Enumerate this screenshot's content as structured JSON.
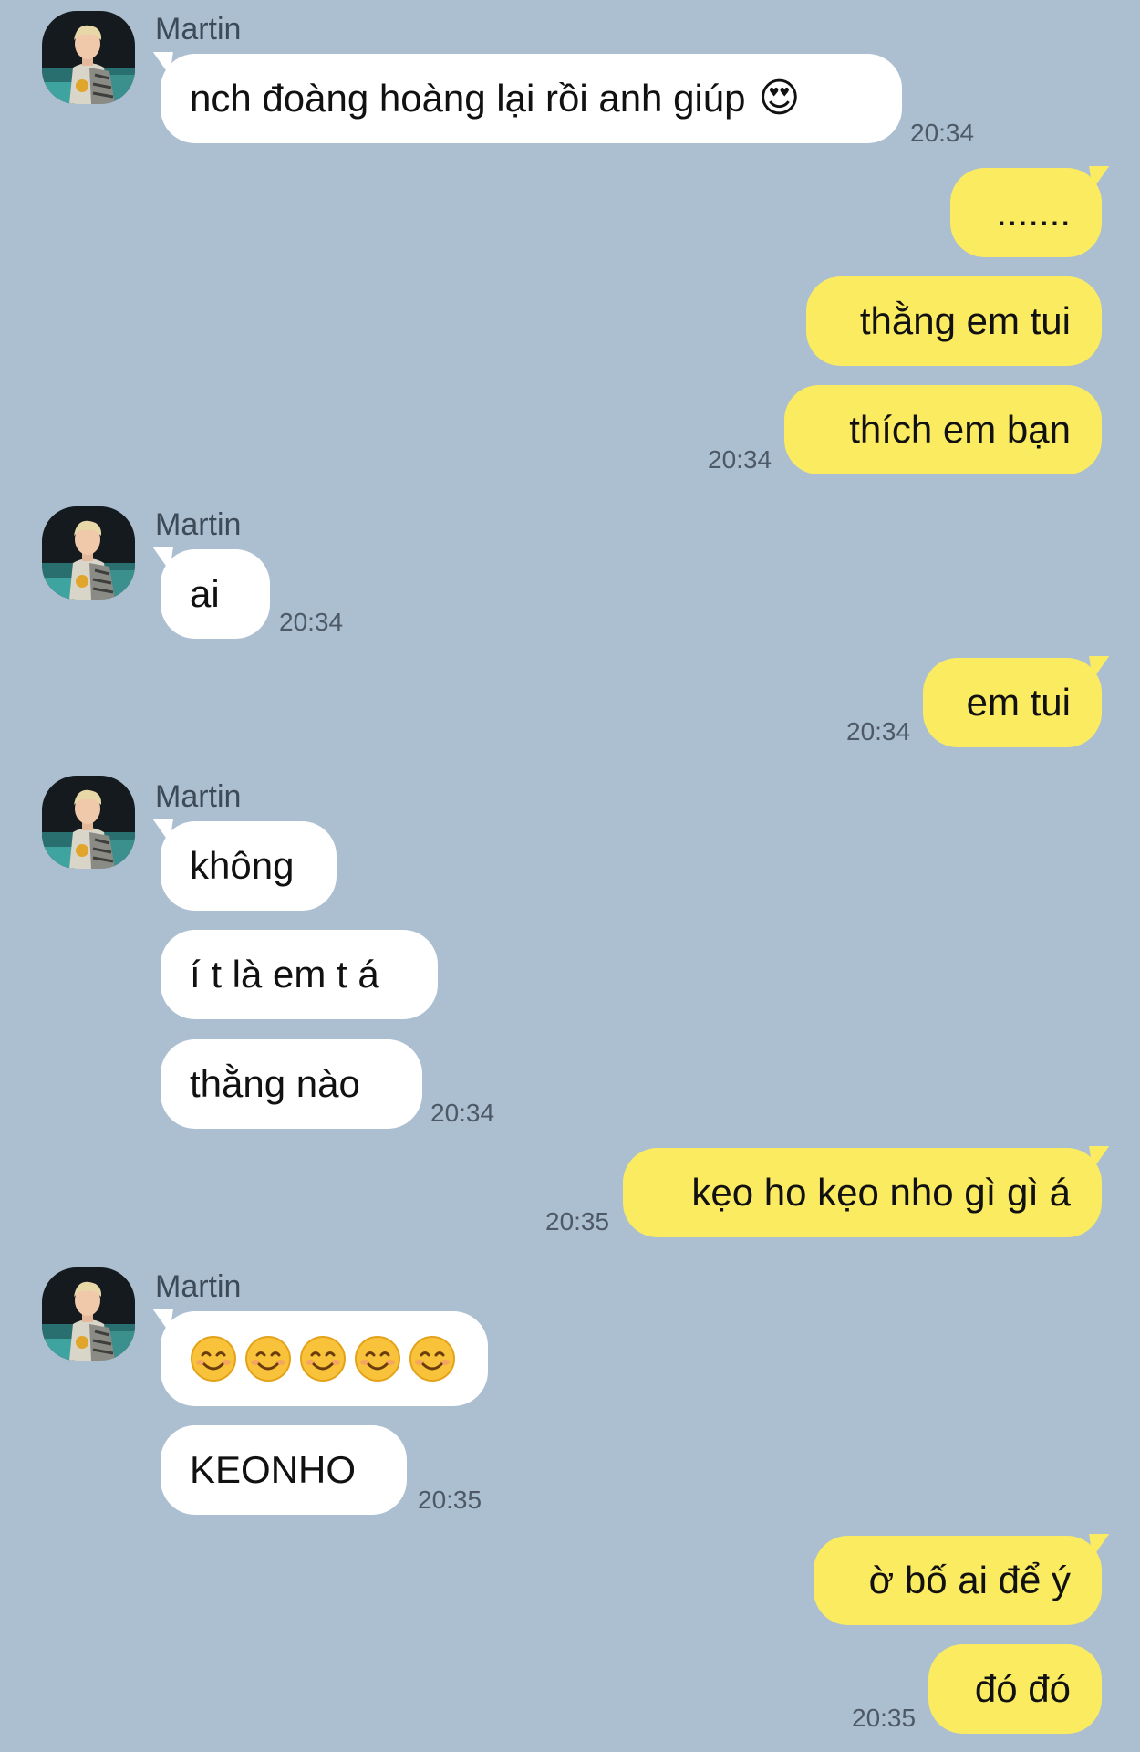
{
  "contact": {
    "name": "Martin"
  },
  "messages": {
    "m1": {
      "text": "nch đoàng hoàng lại rồi anh giúp",
      "emoji": "😍",
      "time": "20:34"
    },
    "m2": {
      "text": "......."
    },
    "m3": {
      "text": "thằng em tui"
    },
    "m4": {
      "text": "thích em bạn",
      "time": "20:34"
    },
    "m5": {
      "text": "ai",
      "time": "20:34"
    },
    "m6": {
      "text": "em tui",
      "time": "20:34"
    },
    "m7": {
      "text": "không"
    },
    "m8": {
      "text": "í t là em t á"
    },
    "m9": {
      "text": "thằng nào",
      "time": "20:34"
    },
    "m10": {
      "text": "kẹo ho kẹo nho gì gì á",
      "time": "20:35"
    },
    "m11": {
      "emoji_icons": [
        "smiling-face-icon",
        "smiling-face-icon",
        "smiling-face-icon",
        "smiling-face-icon",
        "smiling-face-icon"
      ]
    },
    "m12": {
      "text": "KEONHO",
      "time": "20:35"
    },
    "m13": {
      "text": "ờ bố ai để ý"
    },
    "m14": {
      "text": "đó đó",
      "time": "20:35"
    }
  },
  "colors": {
    "background": "#acbfd0",
    "incoming_bubble": "#ffffff",
    "outgoing_bubble": "#fbeb61",
    "timestamp": "#4d5966"
  }
}
